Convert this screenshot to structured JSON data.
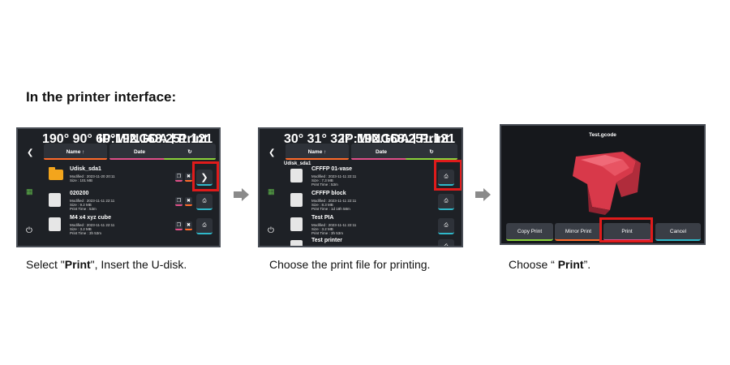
{
  "heading": "In the printer interface:",
  "captions": {
    "c1_pre": "Select \"",
    "c1_bold": "Print",
    "c1_post": "\", Insert the U-disk.",
    "c2": "Choose the print file for printing.",
    "c3_pre": "Choose “ ",
    "c3_bold": "Print",
    "c3_post": "”."
  },
  "panel1": {
    "status_left": "190°  90°  60°",
    "status_mid": "MINGDA  | Print",
    "status_right": "IP:192.168.251.121",
    "tabs": [
      "Name ↑",
      "Date",
      "↻"
    ],
    "rows": [
      {
        "name": "Udisk_sda1",
        "meta": "Modified : 2023-11-20 20:11\nSize : 101 MB"
      },
      {
        "name": "020200",
        "meta": "Modified : 2023-11-11 22:11\nSize : 9.2 MB\nPrint Time : 53m"
      },
      {
        "name": "M4 x4 xyz cube",
        "meta": "Modified : 2023-11-11 22:11\nSize : 3.2 MB\nPrint Time : 3h 53m"
      }
    ]
  },
  "panel2": {
    "status_left": "30°  31°  32°",
    "status_mid": "MINGDA  | Print",
    "status_right": "IP:192.168.251.121",
    "tabs": [
      "Name ↑",
      "Date",
      "↻"
    ],
    "folder": "Udisk_sda1",
    "rows": [
      {
        "name": "CFFFP 01-vase",
        "meta": "Modified : 2023-11-11 22:11\nSize : 7.3 MB\nPrint Time : 53m"
      },
      {
        "name": "CFFFP block",
        "meta": "Modified : 2023-11-11 22:11\nSize : 8.3 MB\nPrint Time : 1d 18h 58m"
      },
      {
        "name": "Test PIA",
        "meta": "Modified : 2023-11-11 22:11\nSize : 3.2 MB\nPrint Time : 3h 53m"
      },
      {
        "name": "Test printer",
        "meta": ""
      }
    ]
  },
  "panel3": {
    "file": "Test.gcode",
    "buttons": [
      "Copy Print",
      "Mirror Print",
      "Print",
      "Cancel"
    ]
  },
  "colors": {
    "accent_red": "#e01b1b",
    "model_red": "#d8394a",
    "cyan": "#2fb8c9"
  }
}
